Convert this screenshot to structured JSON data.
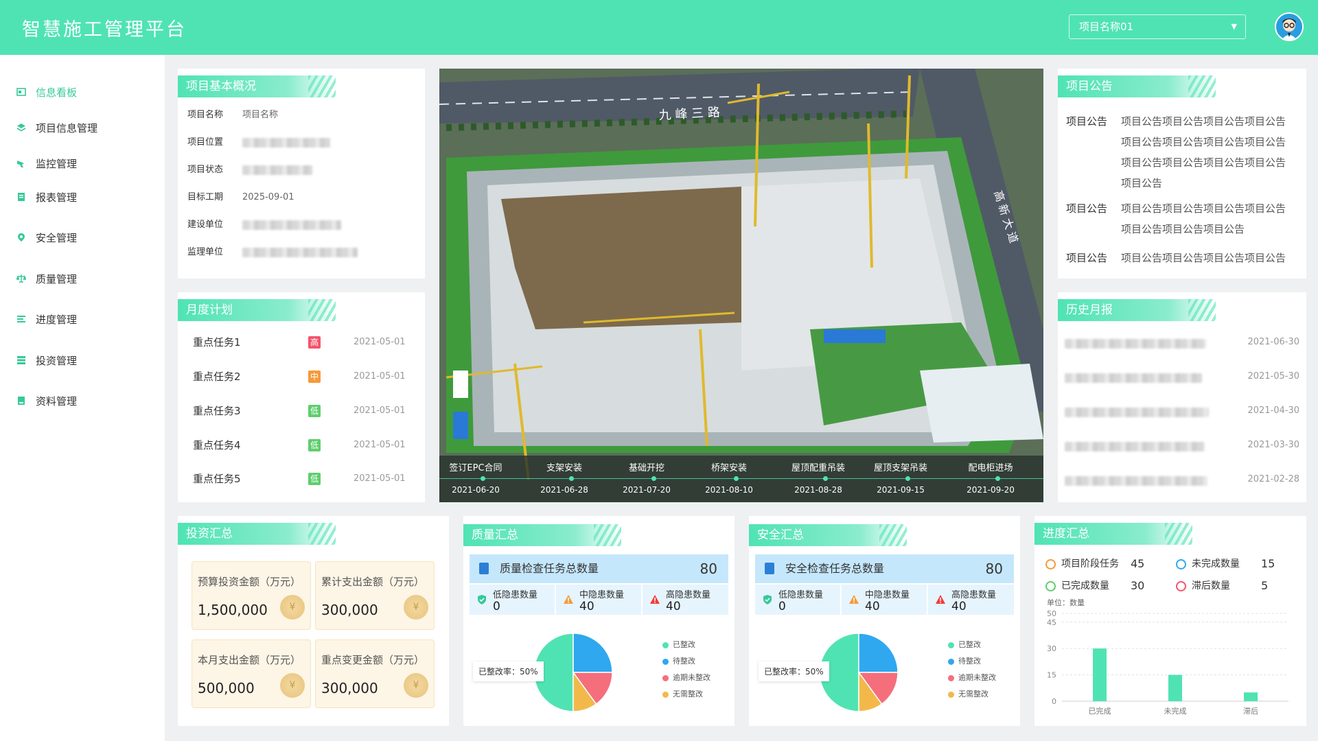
{
  "header": {
    "title": "智慧施工管理平台",
    "project_select": "项目名称01"
  },
  "sidebar": {
    "items": [
      {
        "label": "信息看板",
        "icon": "dashboard-icon",
        "active": true
      },
      {
        "label": "项目信息管理",
        "icon": "layers-icon"
      },
      {
        "label": "监控管理",
        "icon": "camera-icon"
      },
      {
        "label": "报表管理",
        "icon": "report-icon"
      },
      {
        "label": "安全管理",
        "icon": "location-icon"
      },
      {
        "label": "质量管理",
        "icon": "scale-icon"
      },
      {
        "label": "进度管理",
        "icon": "list-icon"
      },
      {
        "label": "投资管理",
        "icon": "stack-icon"
      },
      {
        "label": "资料管理",
        "icon": "folder-icon"
      }
    ]
  },
  "overview": {
    "title": "项目基本概况",
    "rows": [
      {
        "label": "项目名称",
        "value": "项目名称"
      },
      {
        "label": "项目位置",
        "value": ""
      },
      {
        "label": "项目状态",
        "value": ""
      },
      {
        "label": "目标工期",
        "value": "2025-09-01"
      },
      {
        "label": "建设单位",
        "value": ""
      },
      {
        "label": "监理单位",
        "value": ""
      }
    ]
  },
  "monthly": {
    "title": "月度计划",
    "rows": [
      {
        "name": "重点任务1",
        "level": "高",
        "color": "#f4546a",
        "date": "2021-05-01"
      },
      {
        "name": "重点任务2",
        "level": "中",
        "color": "#f59a3a",
        "date": "2021-05-01"
      },
      {
        "name": "重点任务3",
        "level": "低",
        "color": "#5fce6d",
        "date": "2021-05-01"
      },
      {
        "name": "重点任务4",
        "level": "低",
        "color": "#5fce6d",
        "date": "2021-05-01"
      },
      {
        "name": "重点任务5",
        "level": "低",
        "color": "#5fce6d",
        "date": "2021-05-01"
      }
    ]
  },
  "timeline": [
    {
      "event": "签订EPC合同",
      "date": "2021-06-20"
    },
    {
      "event": "支架安装",
      "date": "2021-06-28"
    },
    {
      "event": "基础开挖",
      "date": "2021-07-20"
    },
    {
      "event": "桥架安装",
      "date": "2021-08-10"
    },
    {
      "event": "屋顶配重吊装",
      "date": "2021-08-28"
    },
    {
      "event": "屋顶支架吊装",
      "date": "2021-09-15"
    },
    {
      "event": "配电柜进场",
      "date": "2021-09-20"
    }
  ],
  "site_image": {
    "road_label_top": "九 峰 三 路",
    "road_label_right": "高 新 大 道"
  },
  "notice": {
    "title": "项目公告",
    "rows": [
      {
        "label": "项目公告",
        "lines": [
          "项目公告项目公告项目公告项目公告",
          "项目公告项目公告项目公告项目公告",
          "项目公告项目公告项目公告项目公告",
          "项目公告"
        ]
      },
      {
        "label": "项目公告",
        "lines": [
          "项目公告项目公告项目公告项目公告",
          "项目公告项目公告项目公告"
        ]
      },
      {
        "label": "项目公告",
        "lines": [
          "项目公告项目公告项目公告项目公告"
        ]
      }
    ]
  },
  "history": {
    "title": "历史月报",
    "rows": [
      {
        "date": "2021-06-30"
      },
      {
        "date": "2021-05-30"
      },
      {
        "date": "2021-04-30"
      },
      {
        "date": "2021-03-30"
      },
      {
        "date": "2021-02-28"
      }
    ]
  },
  "investment": {
    "title": "投资汇总",
    "boxes": [
      {
        "label": "预算投资金额（万元）",
        "value": "1,500,000"
      },
      {
        "label": "累计支出金额（万元）",
        "value": "300,000"
      },
      {
        "label": "本月支出金额（万元）",
        "value": "500,000"
      },
      {
        "label": "重点变更金额（万元）",
        "value": "300,000"
      }
    ],
    "coin_glyph": "¥"
  },
  "quality": {
    "title": "质量汇总",
    "total_label": "质量检查任务总数量",
    "total": "80",
    "low_label": "低隐患数量",
    "low": "0",
    "mid_label": "中隐患数量",
    "mid": "40",
    "high_label": "高隐患数量",
    "high": "40",
    "rate_label": "已整改率：",
    "rate": "50%",
    "legend": [
      "已整改",
      "待整改",
      "逾期未整改",
      "无需整改"
    ]
  },
  "safety": {
    "title": "安全汇总",
    "total_label": "安全检查任务总数量",
    "total": "80",
    "low_label": "低隐患数量",
    "low": "0",
    "mid_label": "中隐患数量",
    "mid": "40",
    "high_label": "高隐患数量",
    "high": "40",
    "rate_label": "已整改率：",
    "rate": "50%",
    "legend": [
      "已整改",
      "待整改",
      "逾期未整改",
      "无需整改"
    ]
  },
  "pie_colors": [
    "#4fe3b3",
    "#2fa8f0",
    "#f56e7c",
    "#f2b94a"
  ],
  "pie_shares": [
    0.5,
    0.25,
    0.15,
    0.1
  ],
  "progress": {
    "title": "进度汇总",
    "stats": [
      {
        "label": "项目阶段任务",
        "value": "45",
        "color": "#f59a3a"
      },
      {
        "label": "未完成数量",
        "value": "15",
        "color": "#2fa8f0"
      },
      {
        "label": "已完成数量",
        "value": "30",
        "color": "#5fce6d"
      },
      {
        "label": "滞后数量",
        "value": "5",
        "color": "#f4546a"
      }
    ],
    "unit_label": "单位：数量"
  },
  "chart_data": {
    "type": "bar",
    "categories": [
      "已完成",
      "未完成",
      "滞后"
    ],
    "values": [
      30,
      15,
      5
    ],
    "ylabel": "单位：数量",
    "yticks": [
      0,
      15,
      30,
      45,
      50
    ],
    "ylim": [
      0,
      50
    ],
    "color": "#4fe3b3"
  }
}
